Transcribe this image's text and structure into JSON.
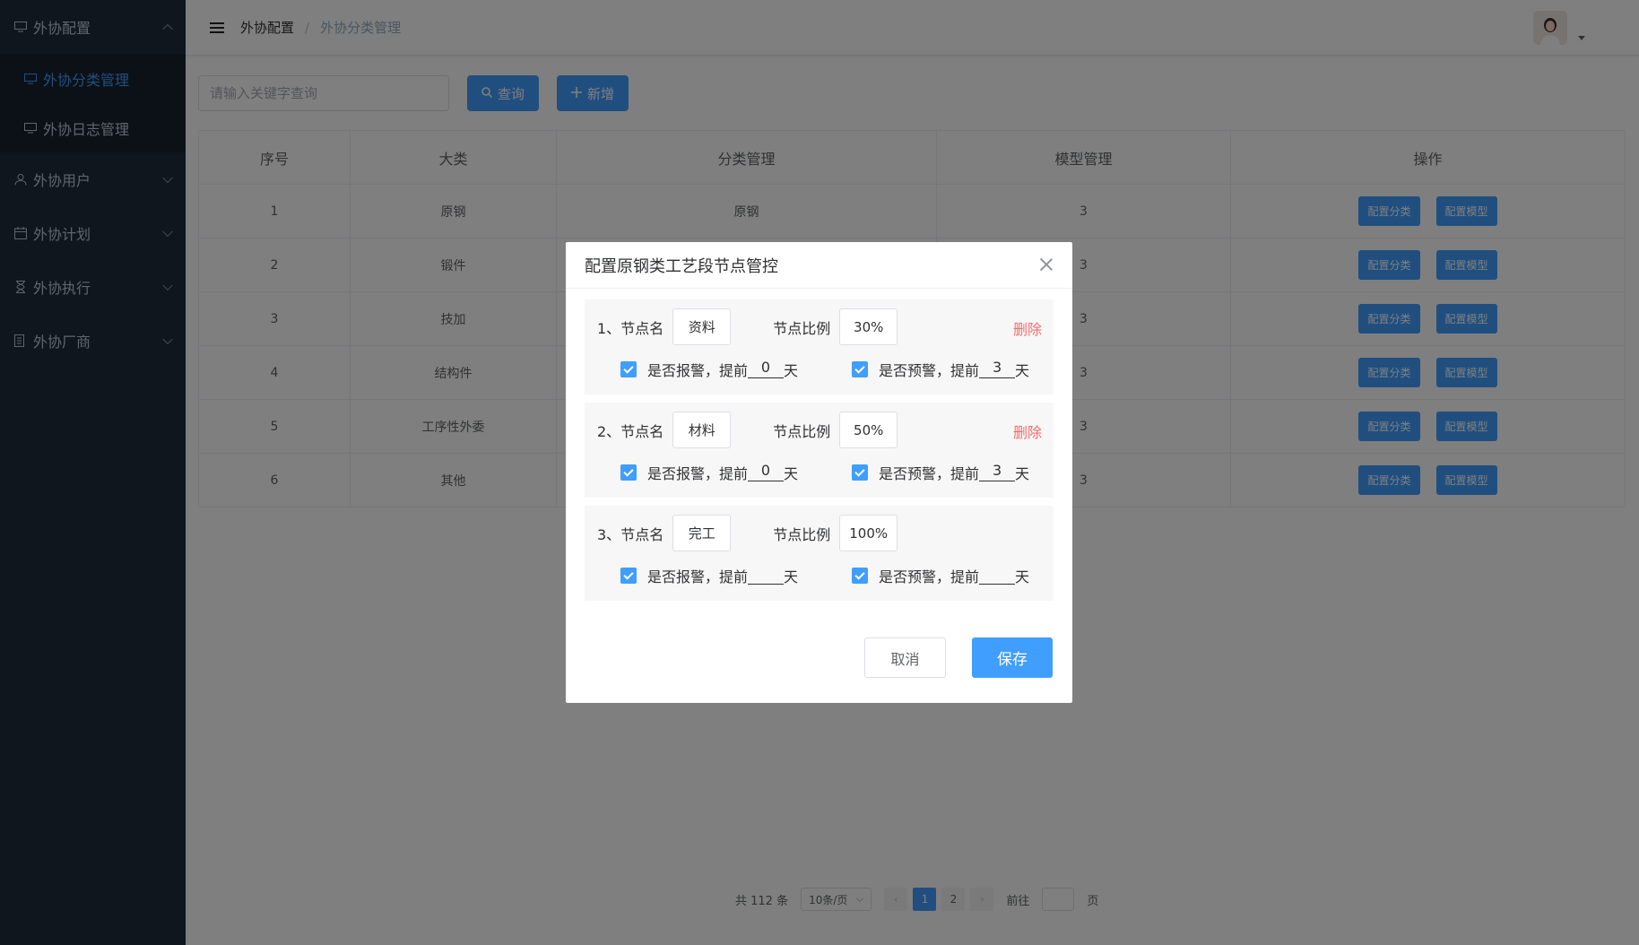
{
  "sidebar": {
    "groups": [
      {
        "label": "外协配置",
        "expanded": true,
        "items": [
          {
            "label": "外协分类管理",
            "active": true
          },
          {
            "label": "外协日志管理",
            "active": false
          }
        ]
      },
      {
        "label": "外协用户"
      },
      {
        "label": "外协计划"
      },
      {
        "label": "外协执行"
      },
      {
        "label": "外协厂商"
      }
    ]
  },
  "header": {
    "breadcrumb": [
      "外协配置",
      "外协分类管理"
    ],
    "separator": "/"
  },
  "toolbar": {
    "search_placeholder": "请输入关键字查询",
    "search_label": "查询",
    "add_label": "新增"
  },
  "table": {
    "columns": [
      "序号",
      "大类",
      "分类管理",
      "模型管理",
      "操作"
    ],
    "rows": [
      {
        "index": "1",
        "category": "原钢",
        "classify": "原钢",
        "model": "3"
      },
      {
        "index": "2",
        "category": "锻件",
        "classify": "",
        "model": "3"
      },
      {
        "index": "3",
        "category": "技加",
        "classify": "",
        "model": "3"
      },
      {
        "index": "4",
        "category": "结构件",
        "classify": "",
        "model": "3"
      },
      {
        "index": "5",
        "category": "工序性外委",
        "classify": "",
        "model": "3"
      },
      {
        "index": "6",
        "category": "其他",
        "classify": "",
        "model": "3"
      }
    ],
    "op_config_classify": "配置分类",
    "op_config_model": "配置模型"
  },
  "pagination": {
    "total": "共 112 条",
    "page_size": "10条/页",
    "pages": [
      "1",
      "2"
    ],
    "current": "1",
    "goto_prefix": "前往",
    "goto_suffix": "页"
  },
  "dialog": {
    "title": "配置原钢类工艺段节点管控",
    "node_label": "节点名",
    "ratio_label": "节点比例",
    "delete_label": "删除",
    "alarm_label": "是否报警，提前",
    "warn_label": "是否预警，提前",
    "day_label": "天",
    "nodes": [
      {
        "prefix": "1、",
        "name": "资料",
        "ratio": "30%",
        "deletable": true,
        "alarm_days": "0",
        "warn_days": "3"
      },
      {
        "prefix": "2、",
        "name": "材料",
        "ratio": "50%",
        "deletable": true,
        "alarm_days": "0",
        "warn_days": "3"
      },
      {
        "prefix": "3、",
        "name": "完工",
        "ratio": "100%",
        "deletable": false,
        "alarm_days": "",
        "warn_days": ""
      }
    ],
    "cancel_label": "取消",
    "save_label": "保存"
  },
  "colors": {
    "primary": "#409eff",
    "sidebar_bg": "#1f2d3d",
    "danger": "#f56c6c"
  }
}
